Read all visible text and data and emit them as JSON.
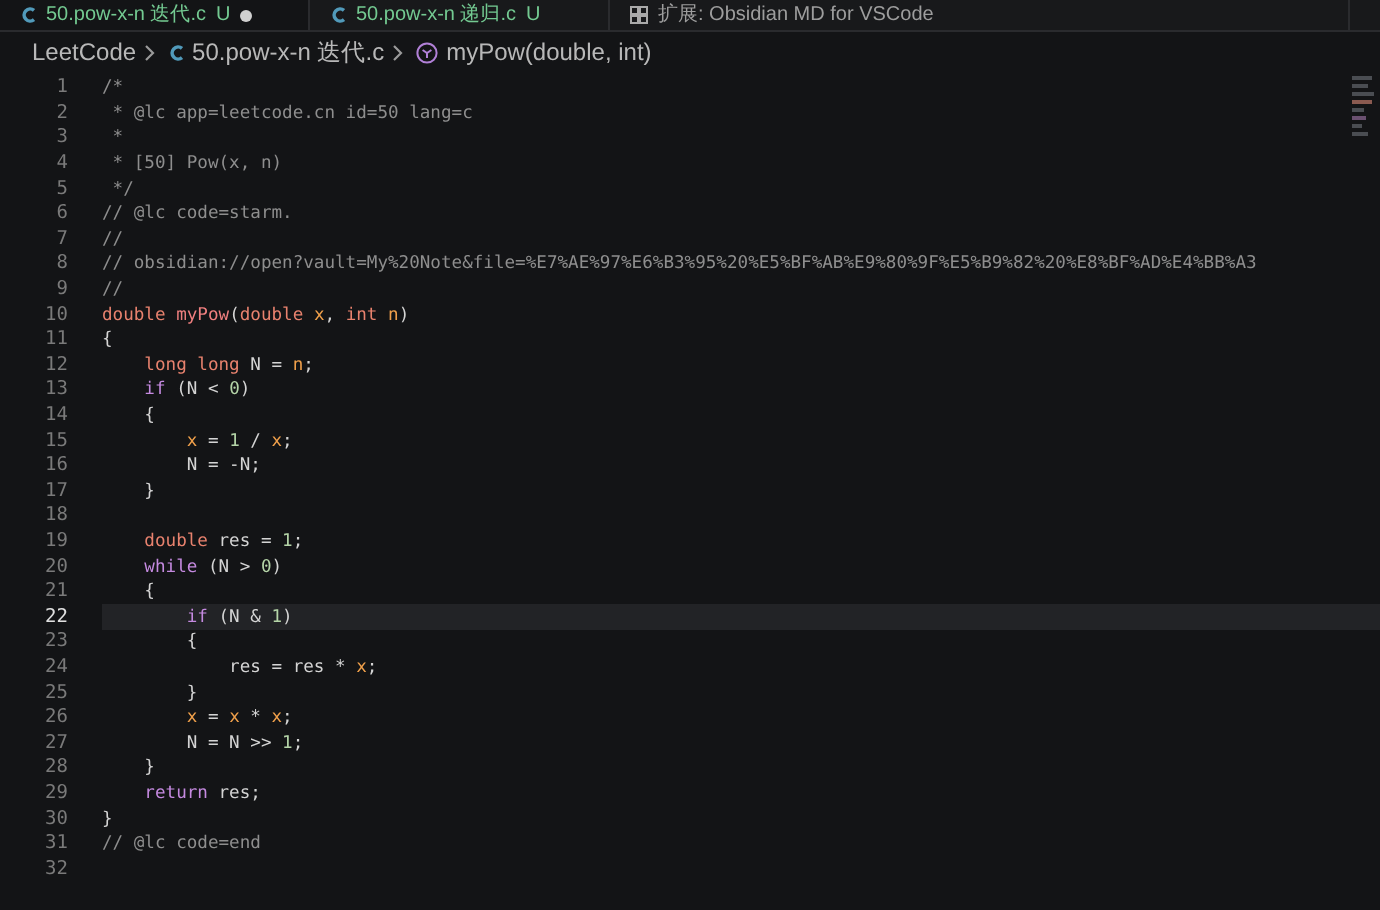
{
  "tabs": [
    {
      "label": "50.pow-x-n 迭代.c",
      "badge": "U",
      "kind": "c",
      "selected": true,
      "dirty": true
    },
    {
      "label": "50.pow-x-n 递归.c",
      "badge": "U",
      "kind": "c",
      "selected": false,
      "dirty": false
    },
    {
      "label": "扩展: Obsidian MD for VSCode",
      "kind": "extension",
      "selected": false,
      "dirty": false
    }
  ],
  "breadcrumb": [
    {
      "label": "LeetCode",
      "kind": "folder"
    },
    {
      "label": "50.pow-x-n 迭代.c",
      "kind": "c"
    },
    {
      "label": "myPow(double, int)",
      "kind": "symbol"
    }
  ],
  "code": {
    "lines": [
      {
        "number": "1",
        "current": false,
        "tokens": [
          {
            "kind": "comment",
            "text": "/*"
          }
        ]
      },
      {
        "number": "2",
        "current": false,
        "tokens": [
          {
            "kind": "comment",
            "text": " * @lc app=leetcode.cn id=50 lang=c"
          }
        ]
      },
      {
        "number": "3",
        "current": false,
        "tokens": [
          {
            "kind": "comment",
            "text": " *"
          }
        ]
      },
      {
        "number": "4",
        "current": false,
        "tokens": [
          {
            "kind": "comment",
            "text": " * [50] Pow(x, n)"
          }
        ]
      },
      {
        "number": "5",
        "current": false,
        "tokens": [
          {
            "kind": "comment",
            "text": " */"
          }
        ]
      },
      {
        "number": "6",
        "current": false,
        "tokens": [
          {
            "kind": "comment",
            "text": "// @lc code=starm."
          }
        ]
      },
      {
        "number": "7",
        "current": false,
        "tokens": [
          {
            "kind": "comment",
            "text": "//"
          }
        ]
      },
      {
        "number": "8",
        "current": false,
        "tokens": [
          {
            "kind": "comment",
            "text": "// obsidian://open?vault=My%20Note&file=%E7%AE%97%E6%B3%95%20%E5%BF%AB%E9%80%9F%E5%B9%82%20%E8%BF%AD%E4%BB%A3"
          }
        ]
      },
      {
        "number": "9",
        "current": false,
        "tokens": [
          {
            "kind": "comment",
            "text": "//"
          }
        ]
      },
      {
        "number": "10",
        "current": false,
        "tokens": [
          {
            "kind": "type",
            "text": "double "
          },
          {
            "kind": "function",
            "text": "myPow"
          },
          {
            "kind": "plain",
            "text": "("
          },
          {
            "kind": "type",
            "text": "double "
          },
          {
            "kind": "param",
            "text": "x"
          },
          {
            "kind": "plain",
            "text": ", "
          },
          {
            "kind": "type",
            "text": "int "
          },
          {
            "kind": "param",
            "text": "n"
          },
          {
            "kind": "plain",
            "text": ")"
          }
        ]
      },
      {
        "number": "11",
        "current": false,
        "tokens": [
          {
            "kind": "plain",
            "text": "{"
          }
        ]
      },
      {
        "number": "12",
        "current": false,
        "tokens": [
          {
            "kind": "type",
            "text": "    long long "
          },
          {
            "kind": "plain",
            "text": "N = "
          },
          {
            "kind": "param",
            "text": "n"
          },
          {
            "kind": "plain",
            "text": ";"
          }
        ]
      },
      {
        "number": "13",
        "current": false,
        "tokens": [
          {
            "kind": "control",
            "text": "    if "
          },
          {
            "kind": "plain",
            "text": "(N < "
          },
          {
            "kind": "number",
            "text": "0"
          },
          {
            "kind": "plain",
            "text": ")"
          }
        ]
      },
      {
        "number": "14",
        "current": false,
        "tokens": [
          {
            "kind": "plain",
            "text": "    {"
          }
        ]
      },
      {
        "number": "15",
        "current": false,
        "tokens": [
          {
            "kind": "param",
            "text": "        x"
          },
          {
            "kind": "plain",
            "text": " = "
          },
          {
            "kind": "number",
            "text": "1"
          },
          {
            "kind": "plain",
            "text": " / "
          },
          {
            "kind": "param",
            "text": "x"
          },
          {
            "kind": "plain",
            "text": ";"
          }
        ]
      },
      {
        "number": "16",
        "current": false,
        "tokens": [
          {
            "kind": "plain",
            "text": "        N = -N;"
          }
        ]
      },
      {
        "number": "17",
        "current": false,
        "tokens": [
          {
            "kind": "plain",
            "text": "    }"
          }
        ]
      },
      {
        "number": "18",
        "current": false
      },
      {
        "number": "19",
        "current": false,
        "tokens": [
          {
            "kind": "type",
            "text": "    double "
          },
          {
            "kind": "plain",
            "text": "res = "
          },
          {
            "kind": "number",
            "text": "1"
          },
          {
            "kind": "plain",
            "text": ";"
          }
        ]
      },
      {
        "number": "20",
        "current": false,
        "tokens": [
          {
            "kind": "control",
            "text": "    while "
          },
          {
            "kind": "plain",
            "text": "(N > "
          },
          {
            "kind": "number",
            "text": "0"
          },
          {
            "kind": "plain",
            "text": ")"
          }
        ]
      },
      {
        "number": "21",
        "current": false,
        "tokens": [
          {
            "kind": "plain",
            "text": "    {"
          }
        ]
      },
      {
        "number": "22",
        "current": true,
        "tokens": [
          {
            "kind": "control",
            "text": "        if "
          },
          {
            "kind": "plain",
            "text": "(N & "
          },
          {
            "kind": "number",
            "text": "1"
          },
          {
            "kind": "plain",
            "text": ")"
          }
        ]
      },
      {
        "number": "23",
        "current": false,
        "tokens": [
          {
            "kind": "plain",
            "text": "        {"
          }
        ]
      },
      {
        "number": "24",
        "current": false,
        "tokens": [
          {
            "kind": "plain",
            "text": "            res = res * "
          },
          {
            "kind": "param",
            "text": "x"
          },
          {
            "kind": "plain",
            "text": ";"
          }
        ]
      },
      {
        "number": "25",
        "current": false,
        "tokens": [
          {
            "kind": "plain",
            "text": "        }"
          }
        ]
      },
      {
        "number": "26",
        "current": false,
        "tokens": [
          {
            "kind": "param",
            "text": "        x"
          },
          {
            "kind": "plain",
            "text": " = "
          },
          {
            "kind": "param",
            "text": "x"
          },
          {
            "kind": "plain",
            "text": " * "
          },
          {
            "kind": "param",
            "text": "x"
          },
          {
            "kind": "plain",
            "text": ";"
          }
        ]
      },
      {
        "number": "27",
        "current": false,
        "tokens": [
          {
            "kind": "plain",
            "text": "        N = N >> "
          },
          {
            "kind": "number",
            "text": "1"
          },
          {
            "kind": "plain",
            "text": ";"
          }
        ]
      },
      {
        "number": "28",
        "current": false,
        "tokens": [
          {
            "kind": "plain",
            "text": "    }"
          }
        ]
      },
      {
        "number": "29",
        "current": false,
        "tokens": [
          {
            "kind": "control",
            "text": "    return "
          },
          {
            "kind": "plain",
            "text": "res;"
          }
        ]
      },
      {
        "number": "30",
        "current": false,
        "tokens": [
          {
            "kind": "plain",
            "text": "}"
          }
        ]
      },
      {
        "number": "31",
        "current": false,
        "tokens": [
          {
            "kind": "comment",
            "text": "// @lc code=end"
          }
        ]
      },
      {
        "number": "32",
        "current": false
      }
    ]
  }
}
